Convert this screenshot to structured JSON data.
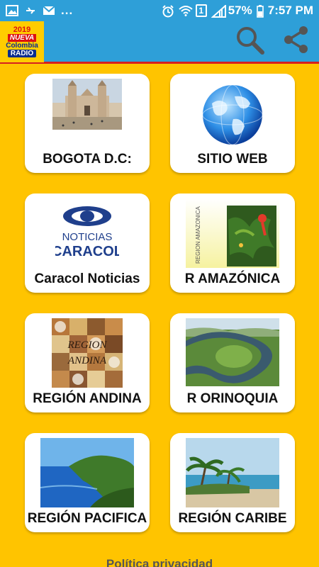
{
  "status_bar": {
    "dots": "...",
    "sim_badge": "1",
    "battery": "57%",
    "time": "7:57 PM",
    "icons": [
      "image-icon",
      "usb-icon",
      "mail-icon",
      "alarm-icon",
      "wifi-icon",
      "signal-icon",
      "battery-icon"
    ]
  },
  "app_bar": {
    "logo": {
      "year": "2019",
      "line1": "NUEVA",
      "line2": "Colombia",
      "line3": "RADIO"
    },
    "actions": [
      "search-icon",
      "share-icon"
    ]
  },
  "cards": [
    {
      "label": "BOGOTA D.C:",
      "image": "cathedral-photo"
    },
    {
      "label": "SITIO WEB",
      "image": "globe-icon"
    },
    {
      "label": "Caracol Noticias",
      "image": "caracol-logo",
      "logo_text_top": "NOTICIAS",
      "logo_text_bottom": "CARACOL"
    },
    {
      "label": "R AMAZÓNICA",
      "image": "amazon-jungle-art",
      "image_text": "REGION AMAZONICA"
    },
    {
      "label": "REGIÓN ANDINA",
      "image": "andean-food-collage",
      "image_text_top": "REGION",
      "image_text_bottom": "ANDINA"
    },
    {
      "label": "R ORINOQUIA",
      "image": "river-bend-photo"
    },
    {
      "label": "REGIÓN PACIFICA",
      "image": "pacific-coast-photo"
    },
    {
      "label": "REGIÓN CARIBE",
      "image": "caribbean-beach-photo"
    }
  ],
  "footer": {
    "text": "Política privacidad"
  },
  "colors": {
    "primary": "#2e9fd8",
    "background": "#FFC400",
    "accent": "#d62020"
  }
}
